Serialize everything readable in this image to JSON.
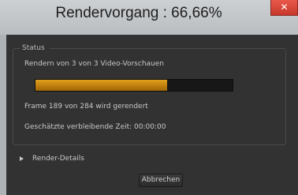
{
  "window": {
    "title": "Rendervorgang : 66,66%",
    "close_label": "✕"
  },
  "status": {
    "legend": "Status",
    "rendering_text": "Rendern von 3 von 3 Video-Vorschauen",
    "progress_fraction": 0.6666,
    "frame_text": "Frame 189 von 284 wird gerendert",
    "remaining_text": "Geschätzte verbleibende Zeit: 00:00:00"
  },
  "details": {
    "label": "Render-Details",
    "icon": "chevron-right-icon"
  },
  "actions": {
    "cancel_label": "Abbrechen"
  },
  "colors": {
    "progress_fill": "#c07f0e",
    "panel_bg": "#323232",
    "close_button": "#c7372b"
  }
}
